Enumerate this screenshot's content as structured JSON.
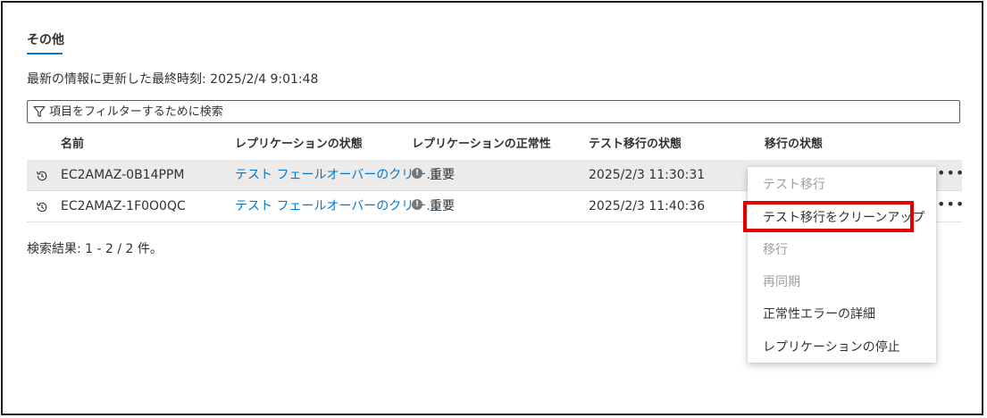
{
  "tab": {
    "label": "その他"
  },
  "updated_text": "最新の情報に更新した最終時刻: 2025/2/4 9:01:48",
  "filter": {
    "placeholder": "項目をフィルターするために検索"
  },
  "columns": [
    "名前",
    "レプリケーションの状態",
    "レプリケーションの正常性",
    "テスト移行の状態",
    "移行の状態"
  ],
  "rows": [
    {
      "name": "EC2AMAZ-0B14PPM",
      "replication_state": "テスト フェールオーバーのクリー…",
      "health": "重要",
      "test_migration": "2025/2/3 11:30:31",
      "selected": true
    },
    {
      "name": "EC2AMAZ-1F0O0QC",
      "replication_state": "テスト フェールオーバーのクリー…",
      "health": "重要",
      "test_migration": "2025/2/3 11:40:36",
      "selected": false
    }
  ],
  "more_label": "•••",
  "results_text": "検索結果: 1 - 2 / 2 件。",
  "context_menu": {
    "items": [
      {
        "label": "テスト移行",
        "disabled": true
      },
      {
        "label": "テスト移行をクリーンアップ",
        "disabled": false
      },
      {
        "label": "移行",
        "disabled": true
      },
      {
        "label": "再同期",
        "disabled": true
      },
      {
        "label": "正常性エラーの詳細",
        "disabled": false
      },
      {
        "label": "レプリケーションの停止",
        "disabled": false
      }
    ]
  },
  "colors": {
    "accent": "#0078d4",
    "highlight": "#e00000",
    "selected_row": "#edebe9",
    "disabled_text": "#a19f9d"
  },
  "icons": {
    "filter": "filter-icon",
    "history": "history-icon",
    "info": "info-icon",
    "more": "more-icon"
  }
}
